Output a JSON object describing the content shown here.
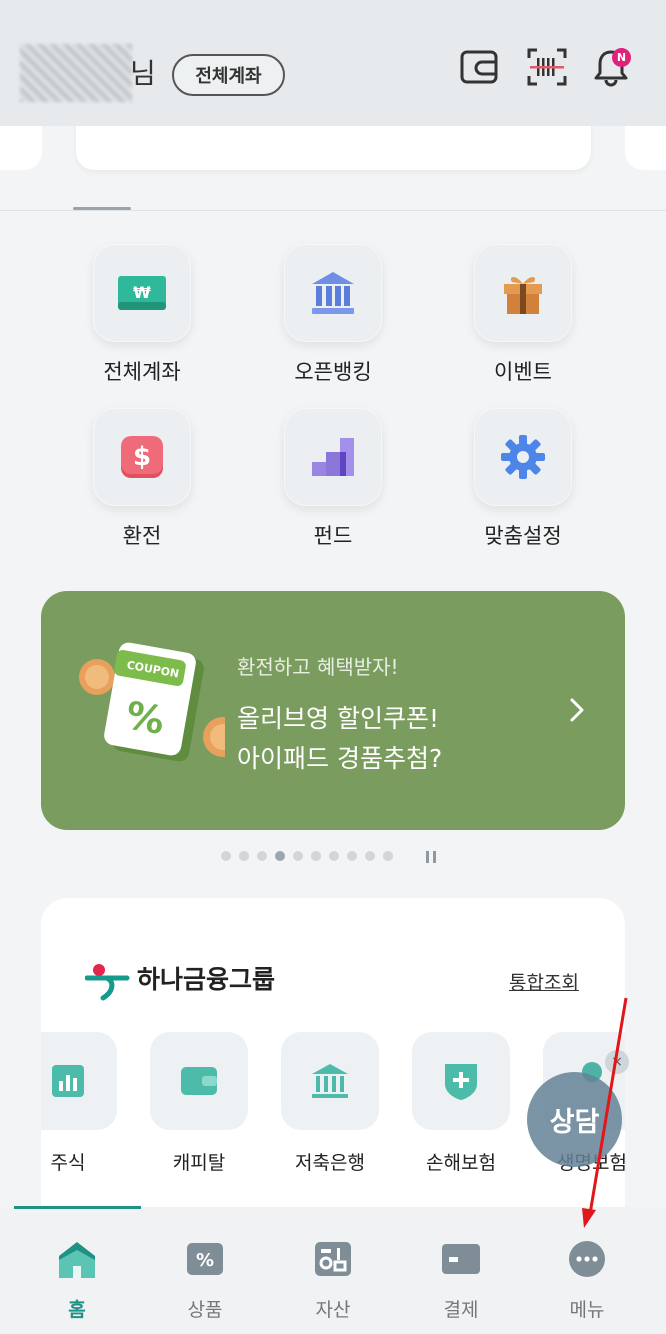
{
  "header": {
    "name_suffix": "님",
    "all_accounts_button": "전체계좌",
    "notification_badge": "N"
  },
  "quick_menu": [
    {
      "label": "전체계좌",
      "icon": "won-bill-icon"
    },
    {
      "label": "오픈뱅킹",
      "icon": "bank-building-icon"
    },
    {
      "label": "이벤트",
      "icon": "gift-box-icon"
    },
    {
      "label": "환전",
      "icon": "dollar-icon"
    },
    {
      "label": "펀드",
      "icon": "fund-chart-icon"
    },
    {
      "label": "맞춤설정",
      "icon": "gear-icon"
    }
  ],
  "banner": {
    "subtitle": "환전하고 혜택받자!",
    "title_line1": "올리브영 할인쿠폰!",
    "title_line2": "아이패드 경품추첨?",
    "coupon_text": "COUPON",
    "coupon_symbol": "%",
    "background_color": "#7b9c5f"
  },
  "carousel": {
    "total": 10,
    "active": 4
  },
  "hana_group": {
    "title": "하나금융그룹",
    "link_label": "통합조회",
    "affiliates": [
      {
        "label": "주식",
        "icon": "stock-chart-icon"
      },
      {
        "label": "캐피탈",
        "icon": "wallet-icon"
      },
      {
        "label": "저축은행",
        "icon": "bank-building-icon"
      },
      {
        "label": "손해보험",
        "icon": "shield-plus-icon"
      },
      {
        "label": "생명보험",
        "icon": "person-icon"
      }
    ]
  },
  "consult_button": {
    "label": "상담",
    "close_symbol": "×"
  },
  "tabbar": {
    "tabs": [
      {
        "label": "홈",
        "active": true
      },
      {
        "label": "상품",
        "active": false
      },
      {
        "label": "자산",
        "active": false
      },
      {
        "label": "결제",
        "active": false
      },
      {
        "label": "메뉴",
        "active": false
      }
    ],
    "accent_color": "#1f9185"
  }
}
